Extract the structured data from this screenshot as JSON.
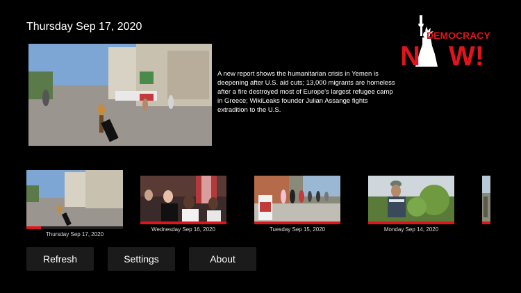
{
  "header": {
    "date": "Thursday Sep 17, 2020"
  },
  "logo": {
    "line1": "DEMOCRACY",
    "line2_a": "N",
    "line2_b": "W!"
  },
  "featured": {
    "description": "A new report shows the humanitarian crisis in Yemen is deepening after U.S. aid cuts; 13,000 migrants are homeless after a fire destroyed most of Europe's largest refugee camp in Greece; WikiLeaks founder Julian Assange fights extradition to the U.S."
  },
  "episodes": [
    {
      "date": "Thursday Sep 17, 2020",
      "progress": 0.15,
      "selected": true
    },
    {
      "date": "Wednesday Sep 16, 2020",
      "progress": 1.0,
      "selected": false
    },
    {
      "date": "Tuesday Sep 15, 2020",
      "progress": 1.0,
      "selected": false
    },
    {
      "date": "Monday Sep 14, 2020",
      "progress": 1.0,
      "selected": false
    },
    {
      "date": "",
      "progress": 1.0,
      "selected": false
    }
  ],
  "buttons": {
    "refresh": "Refresh",
    "settings": "Settings",
    "about": "About"
  },
  "colors": {
    "accent": "#e0151b",
    "background": "#000000",
    "button": "#1b1b1b"
  }
}
